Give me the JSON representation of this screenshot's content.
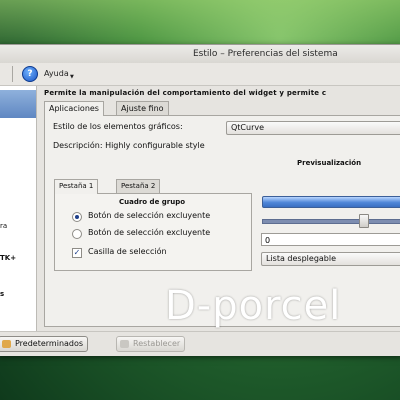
{
  "window": {
    "title": "Estilo – Preferencias del sistema"
  },
  "toolbar": {
    "help_label": "Ayuda",
    "help_icon": "help-icon"
  },
  "sidebar": {
    "items": [
      "ra",
      "TK+",
      "s"
    ]
  },
  "main": {
    "heading": "Permite la manipulación del comportamiento del widget y permite c",
    "tabs": [
      "Aplicaciones",
      "Ajuste fino"
    ],
    "style_label": "Estilo de los elementos gráficos:",
    "style_value": "QtCurve",
    "description": "Descripción: Highly configurable style",
    "preview_title": "Previsualización",
    "inner_tabs": [
      "Pestaña 1",
      "Pestaña 2"
    ],
    "group_title": "Cuadro de grupo",
    "radio1": "Botón de selección excluyente",
    "radio2": "Botón de selección excluyente",
    "checkbox": "Casilla de selección",
    "spin_value": "0",
    "dropdown_value": "Lista desplegable"
  },
  "buttons": {
    "defaults": "Predeterminados",
    "reset": "Restablecer"
  },
  "watermark": "D-porcel",
  "colors": {
    "accent": "#4f86d8",
    "desktop": "#2f7a34"
  }
}
